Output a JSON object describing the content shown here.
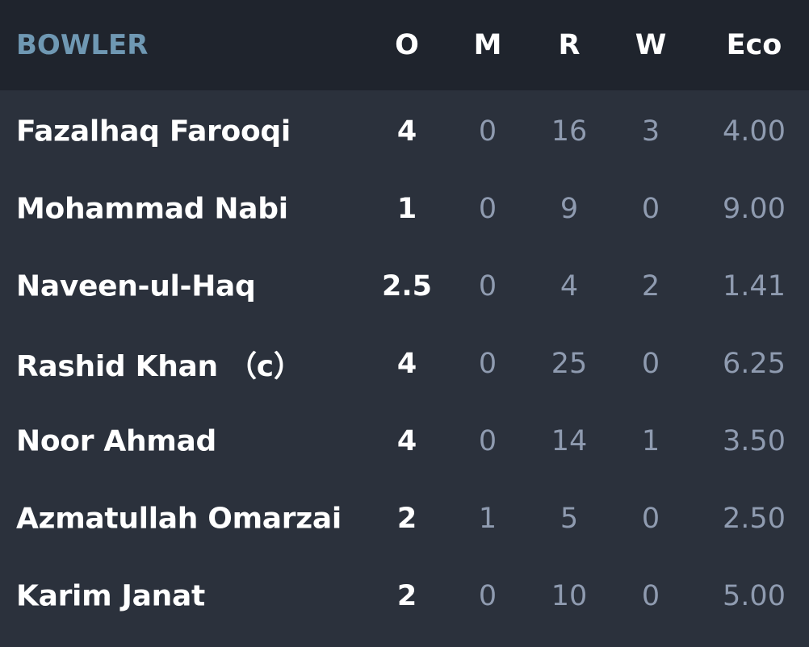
{
  "header": {
    "bowler": "BOWLER",
    "overs": "O",
    "maidens": "M",
    "runs": "R",
    "wickets": "W",
    "economy": "Eco"
  },
  "rows": [
    {
      "name": "Fazalhaq Farooqi",
      "o": "4",
      "m": "0",
      "r": "16",
      "w": "3",
      "eco": "4.00"
    },
    {
      "name": "Mohammad Nabi",
      "o": "1",
      "m": "0",
      "r": "9",
      "w": "0",
      "eco": "9.00"
    },
    {
      "name": "Naveen-ul-Haq",
      "o": "2.5",
      "m": "0",
      "r": "4",
      "w": "2",
      "eco": "1.41"
    },
    {
      "name": "Rashid Khan （c）",
      "o": "4",
      "m": "0",
      "r": "25",
      "w": "0",
      "eco": "6.25"
    },
    {
      "name": "Noor Ahmad",
      "o": "4",
      "m": "0",
      "r": "14",
      "w": "1",
      "eco": "3.50"
    },
    {
      "name": "Azmatullah Omarzai",
      "o": "2",
      "m": "1",
      "r": "5",
      "w": "0",
      "eco": "2.50"
    },
    {
      "name": "Karim Janat",
      "o": "2",
      "m": "0",
      "r": "10",
      "w": "0",
      "eco": "5.00"
    }
  ]
}
